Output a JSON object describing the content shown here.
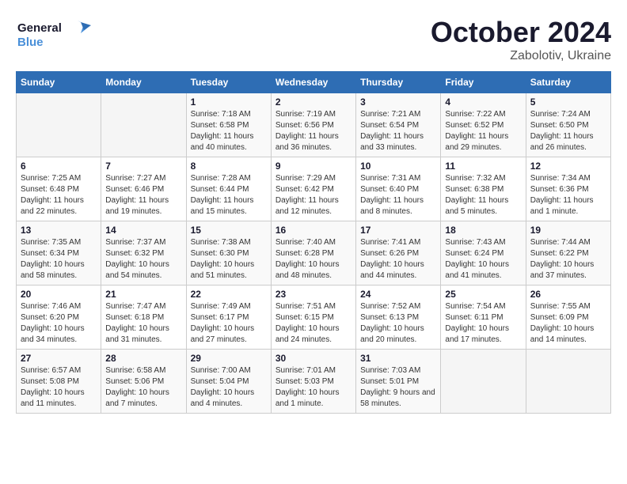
{
  "header": {
    "logo_general": "General",
    "logo_blue": "Blue",
    "month_title": "October 2024",
    "location": "Zabolotiv, Ukraine"
  },
  "weekdays": [
    "Sunday",
    "Monday",
    "Tuesday",
    "Wednesday",
    "Thursday",
    "Friday",
    "Saturday"
  ],
  "weeks": [
    [
      {
        "day": "",
        "sunrise": "",
        "sunset": "",
        "daylight": ""
      },
      {
        "day": "",
        "sunrise": "",
        "sunset": "",
        "daylight": ""
      },
      {
        "day": "1",
        "sunrise": "Sunrise: 7:18 AM",
        "sunset": "Sunset: 6:58 PM",
        "daylight": "Daylight: 11 hours and 40 minutes."
      },
      {
        "day": "2",
        "sunrise": "Sunrise: 7:19 AM",
        "sunset": "Sunset: 6:56 PM",
        "daylight": "Daylight: 11 hours and 36 minutes."
      },
      {
        "day": "3",
        "sunrise": "Sunrise: 7:21 AM",
        "sunset": "Sunset: 6:54 PM",
        "daylight": "Daylight: 11 hours and 33 minutes."
      },
      {
        "day": "4",
        "sunrise": "Sunrise: 7:22 AM",
        "sunset": "Sunset: 6:52 PM",
        "daylight": "Daylight: 11 hours and 29 minutes."
      },
      {
        "day": "5",
        "sunrise": "Sunrise: 7:24 AM",
        "sunset": "Sunset: 6:50 PM",
        "daylight": "Daylight: 11 hours and 26 minutes."
      }
    ],
    [
      {
        "day": "6",
        "sunrise": "Sunrise: 7:25 AM",
        "sunset": "Sunset: 6:48 PM",
        "daylight": "Daylight: 11 hours and 22 minutes."
      },
      {
        "day": "7",
        "sunrise": "Sunrise: 7:27 AM",
        "sunset": "Sunset: 6:46 PM",
        "daylight": "Daylight: 11 hours and 19 minutes."
      },
      {
        "day": "8",
        "sunrise": "Sunrise: 7:28 AM",
        "sunset": "Sunset: 6:44 PM",
        "daylight": "Daylight: 11 hours and 15 minutes."
      },
      {
        "day": "9",
        "sunrise": "Sunrise: 7:29 AM",
        "sunset": "Sunset: 6:42 PM",
        "daylight": "Daylight: 11 hours and 12 minutes."
      },
      {
        "day": "10",
        "sunrise": "Sunrise: 7:31 AM",
        "sunset": "Sunset: 6:40 PM",
        "daylight": "Daylight: 11 hours and 8 minutes."
      },
      {
        "day": "11",
        "sunrise": "Sunrise: 7:32 AM",
        "sunset": "Sunset: 6:38 PM",
        "daylight": "Daylight: 11 hours and 5 minutes."
      },
      {
        "day": "12",
        "sunrise": "Sunrise: 7:34 AM",
        "sunset": "Sunset: 6:36 PM",
        "daylight": "Daylight: 11 hours and 1 minute."
      }
    ],
    [
      {
        "day": "13",
        "sunrise": "Sunrise: 7:35 AM",
        "sunset": "Sunset: 6:34 PM",
        "daylight": "Daylight: 10 hours and 58 minutes."
      },
      {
        "day": "14",
        "sunrise": "Sunrise: 7:37 AM",
        "sunset": "Sunset: 6:32 PM",
        "daylight": "Daylight: 10 hours and 54 minutes."
      },
      {
        "day": "15",
        "sunrise": "Sunrise: 7:38 AM",
        "sunset": "Sunset: 6:30 PM",
        "daylight": "Daylight: 10 hours and 51 minutes."
      },
      {
        "day": "16",
        "sunrise": "Sunrise: 7:40 AM",
        "sunset": "Sunset: 6:28 PM",
        "daylight": "Daylight: 10 hours and 48 minutes."
      },
      {
        "day": "17",
        "sunrise": "Sunrise: 7:41 AM",
        "sunset": "Sunset: 6:26 PM",
        "daylight": "Daylight: 10 hours and 44 minutes."
      },
      {
        "day": "18",
        "sunrise": "Sunrise: 7:43 AM",
        "sunset": "Sunset: 6:24 PM",
        "daylight": "Daylight: 10 hours and 41 minutes."
      },
      {
        "day": "19",
        "sunrise": "Sunrise: 7:44 AM",
        "sunset": "Sunset: 6:22 PM",
        "daylight": "Daylight: 10 hours and 37 minutes."
      }
    ],
    [
      {
        "day": "20",
        "sunrise": "Sunrise: 7:46 AM",
        "sunset": "Sunset: 6:20 PM",
        "daylight": "Daylight: 10 hours and 34 minutes."
      },
      {
        "day": "21",
        "sunrise": "Sunrise: 7:47 AM",
        "sunset": "Sunset: 6:18 PM",
        "daylight": "Daylight: 10 hours and 31 minutes."
      },
      {
        "day": "22",
        "sunrise": "Sunrise: 7:49 AM",
        "sunset": "Sunset: 6:17 PM",
        "daylight": "Daylight: 10 hours and 27 minutes."
      },
      {
        "day": "23",
        "sunrise": "Sunrise: 7:51 AM",
        "sunset": "Sunset: 6:15 PM",
        "daylight": "Daylight: 10 hours and 24 minutes."
      },
      {
        "day": "24",
        "sunrise": "Sunrise: 7:52 AM",
        "sunset": "Sunset: 6:13 PM",
        "daylight": "Daylight: 10 hours and 20 minutes."
      },
      {
        "day": "25",
        "sunrise": "Sunrise: 7:54 AM",
        "sunset": "Sunset: 6:11 PM",
        "daylight": "Daylight: 10 hours and 17 minutes."
      },
      {
        "day": "26",
        "sunrise": "Sunrise: 7:55 AM",
        "sunset": "Sunset: 6:09 PM",
        "daylight": "Daylight: 10 hours and 14 minutes."
      }
    ],
    [
      {
        "day": "27",
        "sunrise": "Sunrise: 6:57 AM",
        "sunset": "Sunset: 5:08 PM",
        "daylight": "Daylight: 10 hours and 11 minutes."
      },
      {
        "day": "28",
        "sunrise": "Sunrise: 6:58 AM",
        "sunset": "Sunset: 5:06 PM",
        "daylight": "Daylight: 10 hours and 7 minutes."
      },
      {
        "day": "29",
        "sunrise": "Sunrise: 7:00 AM",
        "sunset": "Sunset: 5:04 PM",
        "daylight": "Daylight: 10 hours and 4 minutes."
      },
      {
        "day": "30",
        "sunrise": "Sunrise: 7:01 AM",
        "sunset": "Sunset: 5:03 PM",
        "daylight": "Daylight: 10 hours and 1 minute."
      },
      {
        "day": "31",
        "sunrise": "Sunrise: 7:03 AM",
        "sunset": "Sunset: 5:01 PM",
        "daylight": "Daylight: 9 hours and 58 minutes."
      },
      {
        "day": "",
        "sunrise": "",
        "sunset": "",
        "daylight": ""
      },
      {
        "day": "",
        "sunrise": "",
        "sunset": "",
        "daylight": ""
      }
    ]
  ]
}
